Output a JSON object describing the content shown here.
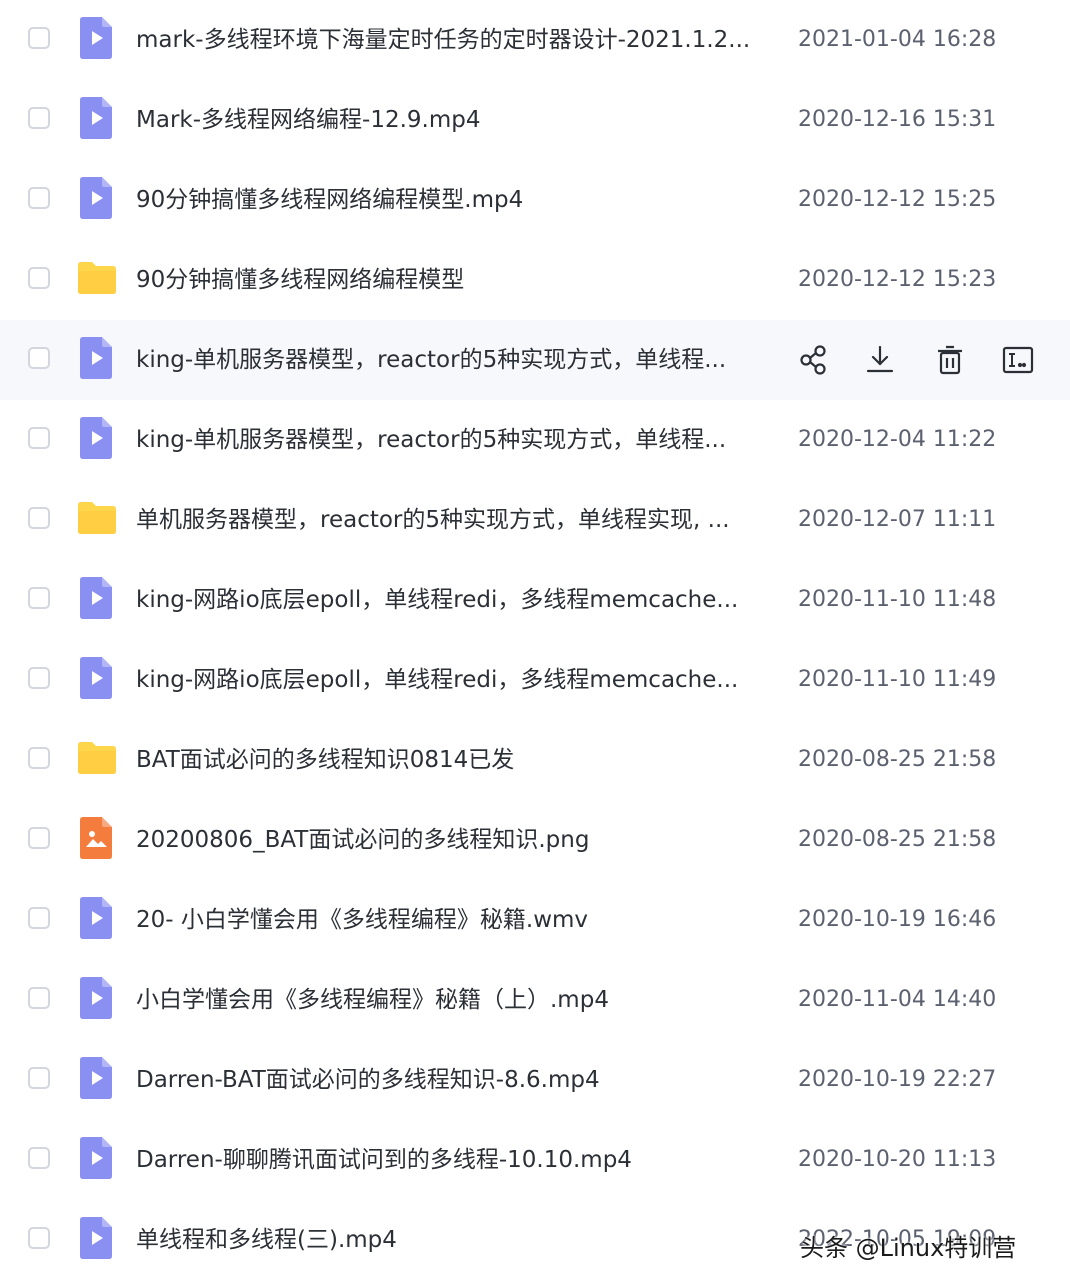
{
  "files": [
    {
      "type": "video",
      "name": "mark-多线程环境下海量定时任务的定时器设计-2021.1.2...",
      "date": "2021-01-04 16:28"
    },
    {
      "type": "video",
      "name": "Mark-多线程网络编程-12.9.mp4",
      "date": "2020-12-16 15:31"
    },
    {
      "type": "video",
      "name": "90分钟搞懂多线程网络编程模型.mp4",
      "date": "2020-12-12 15:25"
    },
    {
      "type": "folder",
      "name": "90分钟搞懂多线程网络编程模型",
      "date": "2020-12-12 15:23"
    },
    {
      "type": "video",
      "name": "king-单机服务器模型，reactor的5种实现方式，单线程...",
      "date": "",
      "hovered": true
    },
    {
      "type": "video",
      "name": "king-单机服务器模型，reactor的5种实现方式，单线程...",
      "date": "2020-12-04 11:22"
    },
    {
      "type": "folder",
      "name": "单机服务器模型，reactor的5种实现方式，单线程实现, ...",
      "date": "2020-12-07 11:11"
    },
    {
      "type": "video",
      "name": "king-网路io底层epoll，单线程redi，多线程memcache...",
      "date": "2020-11-10 11:48"
    },
    {
      "type": "video",
      "name": "king-网路io底层epoll，单线程redi，多线程memcache...",
      "date": "2020-11-10 11:49"
    },
    {
      "type": "folder",
      "name": "BAT面试必问的多线程知识0814已发",
      "date": "2020-08-25 21:58"
    },
    {
      "type": "image",
      "name": "20200806_BAT面试必问的多线程知识.png",
      "date": "2020-08-25 21:58"
    },
    {
      "type": "video",
      "name": "20- 小白学懂会用《多线程编程》秘籍.wmv",
      "date": "2020-10-19 16:46"
    },
    {
      "type": "video",
      "name": "小白学懂会用《多线程编程》秘籍（上）.mp4",
      "date": "2020-11-04 14:40"
    },
    {
      "type": "video",
      "name": "Darren-BAT面试必问的多线程知识-8.6.mp4",
      "date": "2020-10-19 22:27"
    },
    {
      "type": "video",
      "name": "Darren-聊聊腾讯面试问到的多线程-10.10.mp4",
      "date": "2020-10-20 11:13"
    },
    {
      "type": "video",
      "name": "单线程和多线程(三).mp4",
      "date": "2022-10-05 19:09"
    }
  ],
  "hover_actions": [
    {
      "icon": "share-icon"
    },
    {
      "icon": "download-icon"
    },
    {
      "icon": "delete-icon"
    },
    {
      "icon": "rename-icon"
    }
  ],
  "colors": {
    "video_icon": "#8a8ff2",
    "folder_icon": "#ffd54a",
    "image_icon": "#f47c3c",
    "hover_row": "#f7f8fc"
  },
  "watermark": "头条 @Linux特训营"
}
